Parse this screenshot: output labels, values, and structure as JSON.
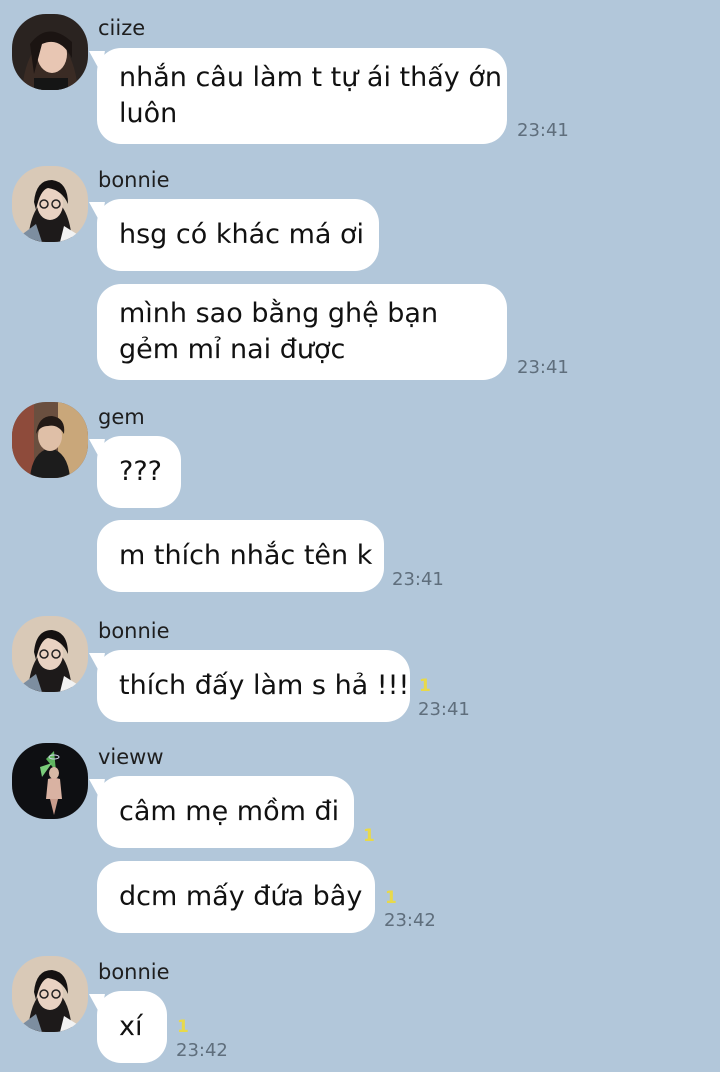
{
  "chat": {
    "groups": [
      {
        "sender": "ciize",
        "avatar": "ciize-profile-photo",
        "messages": [
          {
            "text": "nhắn câu làm t tự ái thấy ớn\nluôn",
            "time": "23:41",
            "unread": ""
          }
        ]
      },
      {
        "sender": "bonnie",
        "avatar": "bonnie-profile-photo",
        "messages": [
          {
            "text": "hsg có khác má ơi",
            "time": "",
            "unread": ""
          },
          {
            "text": "mình sao bằng ghệ bạn\ngẻm mỉ nai được",
            "time": "23:41",
            "unread": ""
          }
        ]
      },
      {
        "sender": "gem",
        "avatar": "gem-profile-photo",
        "messages": [
          {
            "text": "???",
            "time": "",
            "unread": ""
          },
          {
            "text": "m thích nhắc tên k",
            "time": "23:41",
            "unread": ""
          }
        ]
      },
      {
        "sender": "bonnie",
        "avatar": "bonnie-profile-photo",
        "messages": [
          {
            "text": "thích đấy làm s hả !!!",
            "time": "23:41",
            "unread": "1"
          }
        ]
      },
      {
        "sender": "vieww",
        "avatar": "vieww-profile-photo",
        "messages": [
          {
            "text": "câm mẹ mồm đi",
            "time": "",
            "unread": "1"
          },
          {
            "text": "dcm mấy đứa bây",
            "time": "23:42",
            "unread": "1"
          }
        ]
      },
      {
        "sender": "bonnie",
        "avatar": "bonnie-profile-photo",
        "messages": [
          {
            "text": "xí",
            "time": "23:42",
            "unread": "1"
          }
        ]
      }
    ]
  },
  "colors": {
    "background": "#b2c7da",
    "bubble": "#ffffff",
    "unread": "#e8d94a",
    "timestamp": "#5f6e7c"
  }
}
